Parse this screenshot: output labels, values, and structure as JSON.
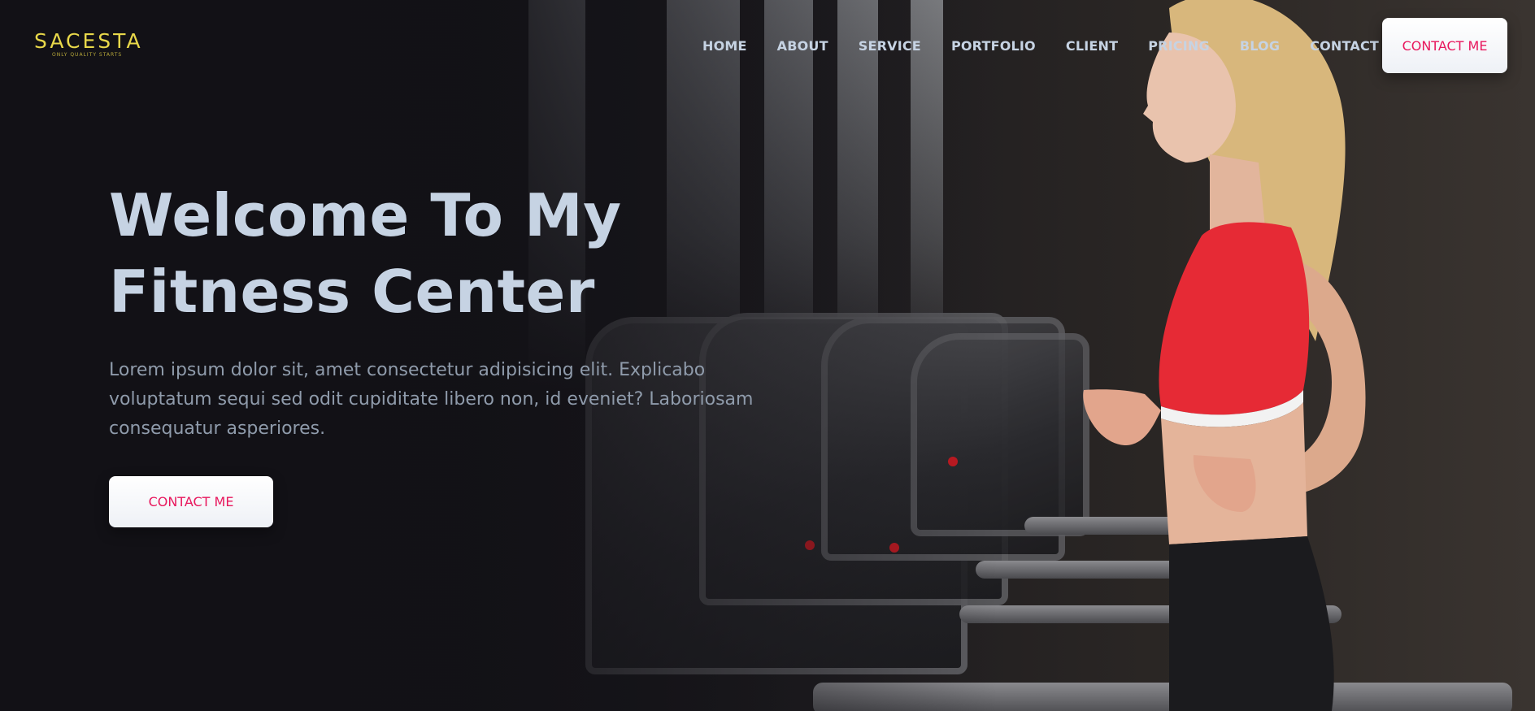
{
  "brand": {
    "name": "SACESTA",
    "tagline": "ONLY QUALITY STARTS",
    "logo_color": "#e8d84a"
  },
  "nav": {
    "items": [
      {
        "label": "HOME"
      },
      {
        "label": "ABOUT"
      },
      {
        "label": "SERVICE"
      },
      {
        "label": "PORTFOLIO"
      },
      {
        "label": "CLIENT"
      },
      {
        "label": "PRICING"
      },
      {
        "label": "BLOG"
      },
      {
        "label": "CONTACT"
      }
    ],
    "cta_label": "CONTACT ME"
  },
  "hero": {
    "title_line1": "Welcome To My",
    "title_line2": "Fitness Center",
    "text": "Lorem ipsum dolor sit, amet consectetur adipisicing elit. Explicabo voluptatum sequi sed odit cupiditate libero non, id eveniet? Laboriosam consequatur asperiores.",
    "cta_label": "CONTACT ME"
  },
  "colors": {
    "accent": "#e8175d",
    "text": "#c6d3e3",
    "muted_text": "#8f9bab",
    "background": "#141317"
  }
}
